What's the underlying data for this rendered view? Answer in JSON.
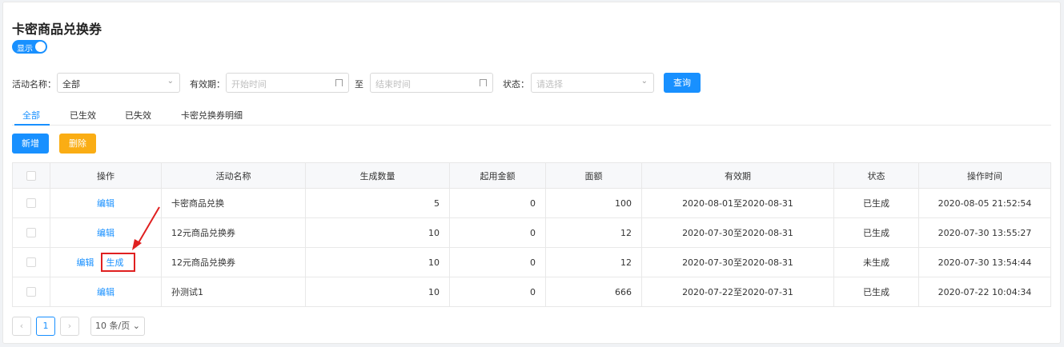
{
  "header": {
    "title": "卡密商品兑换券",
    "toggle_label": "显示"
  },
  "filters": {
    "activity_label": "活动名称：",
    "activity_value": "全部",
    "validity_label": "有效期：",
    "start_placeholder": "开始时间",
    "to_label": "至",
    "end_placeholder": "结束时间",
    "status_label": "状态：",
    "status_placeholder": "请选择",
    "query_button": "查询"
  },
  "tabs": [
    "全部",
    "已生效",
    "已失效",
    "卡密兑换券明细"
  ],
  "toolbar": {
    "add_button": "新增",
    "delete_button": "删除"
  },
  "table": {
    "headers": [
      "操作",
      "活动名称",
      "生成数量",
      "起用金额",
      "面额",
      "有效期",
      "状态",
      "操作时间"
    ],
    "rows": [
      {
        "actions": [
          "编辑"
        ],
        "name": "卡密商品兑换",
        "qty": "5",
        "min_amount": "0",
        "face": "100",
        "validity": "2020-08-01至2020-08-31",
        "status": "已生成",
        "time": "2020-08-05 21:52:54"
      },
      {
        "actions": [
          "编辑"
        ],
        "name": "12元商品兑换券",
        "qty": "10",
        "min_amount": "0",
        "face": "12",
        "validity": "2020-07-30至2020-08-31",
        "status": "已生成",
        "time": "2020-07-30 13:55:27"
      },
      {
        "actions": [
          "编辑",
          "生成"
        ],
        "name": "12元商品兑换券",
        "qty": "10",
        "min_amount": "0",
        "face": "12",
        "validity": "2020-07-30至2020-08-31",
        "status": "未生成",
        "time": "2020-07-30 13:54:44"
      },
      {
        "actions": [
          "编辑"
        ],
        "name": "孙测试1",
        "qty": "10",
        "min_amount": "0",
        "face": "666",
        "validity": "2020-07-22至2020-07-31",
        "status": "已生成",
        "time": "2020-07-22 10:04:34"
      }
    ]
  },
  "pagination": {
    "prev": "‹",
    "current": "1",
    "next": "›",
    "page_size": "10 条/页"
  },
  "colors": {
    "primary": "#1890ff",
    "warning": "#faad14",
    "annotation": "#e02020"
  }
}
